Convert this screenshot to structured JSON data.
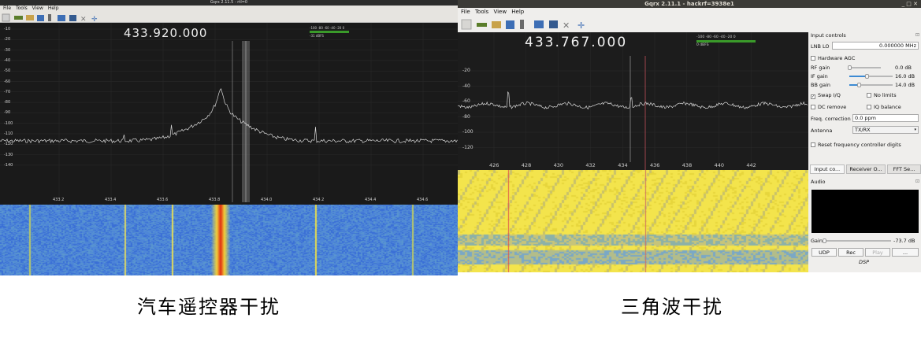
{
  "left_window": {
    "title": "Gqrx 2.11.5 - rtl=0",
    "menu": [
      "File",
      "Tools",
      "View",
      "Help"
    ],
    "frequency": "433.920.000",
    "y_ticks": [
      "-10",
      "-20",
      "-30",
      "-40",
      "-50",
      "-60",
      "-70",
      "-80",
      "-90",
      "-100",
      "-110",
      "-120",
      "-130",
      "-140"
    ],
    "x_ticks": [
      "433.2",
      "433.4",
      "433.6",
      "433.8",
      "434.0",
      "434.2",
      "434.4",
      "434.6"
    ],
    "meter_scale": "-100 -80 -60 -40 -20 0",
    "meter_reading": "-31 dBFS"
  },
  "right_window": {
    "title": "Gqrx 2.11.1 - hackrf=3938e1",
    "window_buttons": "_ □ ✕",
    "menu": [
      "File",
      "Tools",
      "View",
      "Help"
    ],
    "frequency": "433.767.000",
    "y_ticks": [
      "-20",
      "-40",
      "-60",
      "-80",
      "-100",
      "-120"
    ],
    "x_ticks": [
      "426",
      "428",
      "430",
      "432",
      "434",
      "436",
      "438",
      "440",
      "442"
    ],
    "meter_scale": "-100 -80 -60 -40 -20 0",
    "meter_reading": "0 dBFS",
    "input_controls": {
      "header": "Input controls",
      "lnb_label": "LNB LO",
      "lnb_value": "0.000000 MHz",
      "hardware_agc": "Hardware AGC",
      "rf_gain_label": "RF gain",
      "rf_gain_value": "0.0 dB",
      "rf_gain_level": 0.0,
      "if_gain_label": "IF gain",
      "if_gain_value": "16.0 dB",
      "if_gain_level": 0.4,
      "bb_gain_label": "BB gain",
      "bb_gain_value": "14.0 dB",
      "bb_gain_level": 0.22,
      "swap_iq": "Swap I/Q",
      "no_limits": "No limits",
      "dc_remove": "DC remove",
      "iq_balance": "IQ balance",
      "freq_corr_label": "Freq. correction",
      "freq_corr_value": "0.0 ppm",
      "antenna_label": "Antenna",
      "antenna_value": "TX/RX",
      "reset_label": "Reset frequency controller digits"
    },
    "tabs": [
      "Input co...",
      "Receiver O...",
      "FFT Se..."
    ],
    "audio": {
      "header": "Audio",
      "gain_label": "Gain:",
      "gain_value": "-73.7 dB",
      "buttons": [
        "UDP",
        "Rec",
        "Play",
        "..."
      ],
      "dsp_label": "DSP"
    }
  },
  "captions": {
    "left": "汽车遥控器干扰",
    "right": "三角波干扰"
  },
  "colors": {
    "plot_bg": "#1a1a1a",
    "waterfall_left_base": "#3a6fd6",
    "waterfall_right_base": "#f1e04a",
    "signal_line": "#d8d8d8"
  }
}
